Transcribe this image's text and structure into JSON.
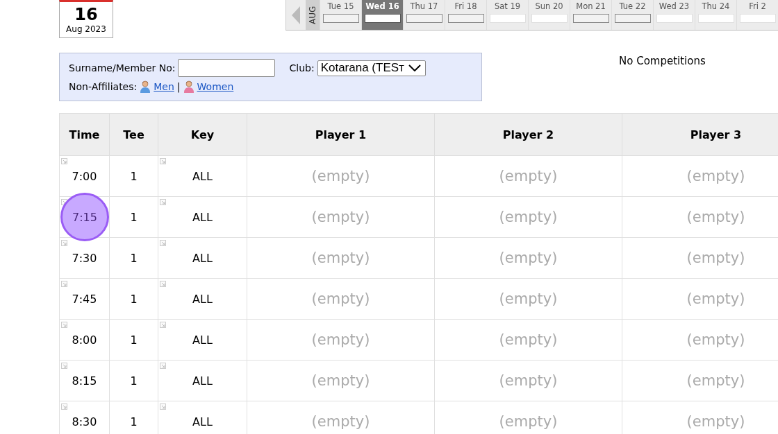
{
  "date_badge": {
    "day": "16",
    "month_year": "Aug 2023"
  },
  "date_strip": {
    "month": "AUG",
    "days": [
      {
        "label": "Tue 15",
        "selected": false,
        "open": true
      },
      {
        "label": "Wed 16",
        "selected": true,
        "open": true
      },
      {
        "label": "Thu 17",
        "selected": false,
        "open": true
      },
      {
        "label": "Fri 18",
        "selected": false,
        "open": true
      },
      {
        "label": "Sat 19",
        "selected": false,
        "open": false
      },
      {
        "label": "Sun 20",
        "selected": false,
        "open": false
      },
      {
        "label": "Mon 21",
        "selected": false,
        "open": true
      },
      {
        "label": "Tue 22",
        "selected": false,
        "open": true
      },
      {
        "label": "Wed 23",
        "selected": false,
        "open": false
      },
      {
        "label": "Thu 24",
        "selected": false,
        "open": false
      },
      {
        "label": "Fri 2",
        "selected": false,
        "open": false
      }
    ]
  },
  "filter": {
    "surname_label": "Surname/Member No:",
    "club_label": "Club:",
    "club_value": "Kotarana (TESᴛ",
    "non_affiliates_label": "Non-Affiliates:",
    "men_link": " Men",
    "separator": "|",
    "women_link": "Women"
  },
  "competitions": "No Competitions",
  "table": {
    "columns": [
      "Time",
      "Tee",
      "Key",
      "Player 1",
      "Player 2",
      "Player 3"
    ],
    "rows": [
      {
        "time": "7:00",
        "tee": "1",
        "key": "ALL",
        "players": [
          "(empty)",
          "(empty)",
          "(empty)"
        ],
        "highlighted": false
      },
      {
        "time": "7:15",
        "tee": "1",
        "key": "ALL",
        "players": [
          "(empty)",
          "(empty)",
          "(empty)"
        ],
        "highlighted": true
      },
      {
        "time": "7:30",
        "tee": "1",
        "key": "ALL",
        "players": [
          "(empty)",
          "(empty)",
          "(empty)"
        ],
        "highlighted": false
      },
      {
        "time": "7:45",
        "tee": "1",
        "key": "ALL",
        "players": [
          "(empty)",
          "(empty)",
          "(empty)"
        ],
        "highlighted": false
      },
      {
        "time": "8:00",
        "tee": "1",
        "key": "ALL",
        "players": [
          "(empty)",
          "(empty)",
          "(empty)"
        ],
        "highlighted": false
      },
      {
        "time": "8:15",
        "tee": "1",
        "key": "ALL",
        "players": [
          "(empty)",
          "(empty)",
          "(empty)"
        ],
        "highlighted": false
      },
      {
        "time": "8:30",
        "tee": "1",
        "key": "ALL",
        "players": [
          "(empty)",
          "(empty)",
          "(empty)"
        ],
        "highlighted": false
      }
    ]
  }
}
